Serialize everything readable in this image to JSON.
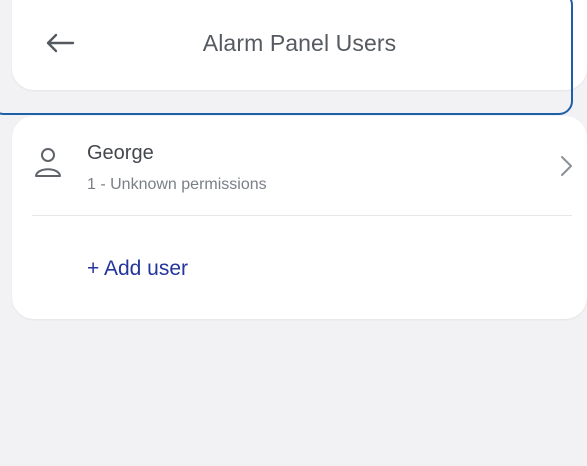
{
  "header": {
    "title": "Alarm Panel Users",
    "back_icon": "arrow-left-icon"
  },
  "users": [
    {
      "name": "George",
      "details": "1 - Unknown permissions",
      "icon": "person-icon",
      "chevron_icon": "chevron-right-icon"
    }
  ],
  "actions": {
    "add_user_label": "+ Add user"
  },
  "colors": {
    "background": "#f2f2f5",
    "card": "#ffffff",
    "selection_outline": "#1f5fa8",
    "link": "#24359b",
    "title_text": "#555a60",
    "secondary_text": "#7a7f86"
  }
}
